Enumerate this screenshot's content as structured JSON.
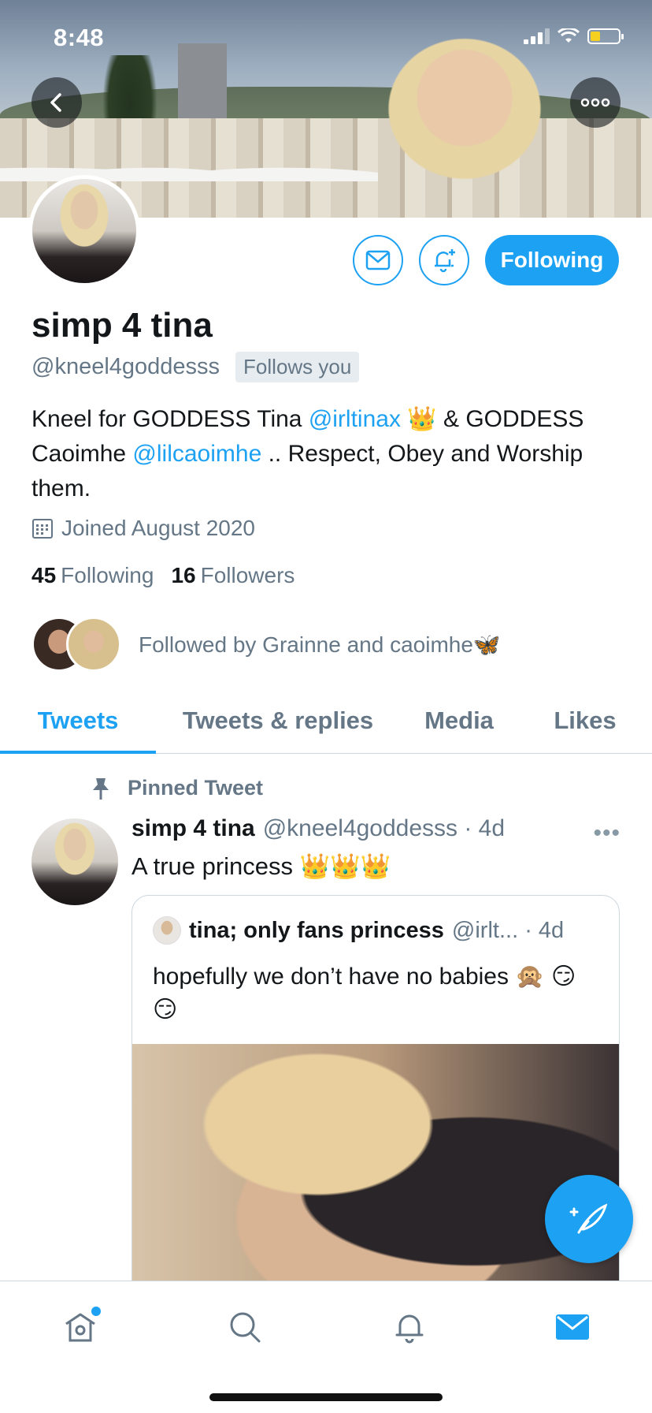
{
  "status_bar": {
    "time": "8:48"
  },
  "profile": {
    "display_name": "simp 4 tina",
    "handle": "@kneel4goddesss",
    "follows_you": "Follows you",
    "follow_button": "Following",
    "bio": {
      "part1": "Kneel for GODDESS Tina ",
      "mention1": "@irltinax",
      "part2": " 👑 & GODDESS Caoimhe ",
      "mention2": "@lilcaoimhe",
      "part3": " .. Respect, Obey and Worship them."
    },
    "joined": "Joined August 2020",
    "following_count": "45",
    "following_label": "Following",
    "followers_count": "16",
    "followers_label": "Followers",
    "followed_by": "Followed by Grainne and caoimhe🦋"
  },
  "tabs": [
    "Tweets",
    "Tweets & replies",
    "Media",
    "Likes"
  ],
  "active_tab": "Tweets",
  "pinned_tweet": {
    "pinned_label": "Pinned Tweet",
    "name": "simp 4 tina",
    "handle_time": "@kneel4goddesss · 4d",
    "text": "A true princess 👑👑👑",
    "quote": {
      "name": "tina; only fans princess",
      "handle_time": "@irlt... · 4d",
      "text": "hopefully we don’t have no babies 🙊 😏😏"
    }
  },
  "bottom_nav": [
    "home-icon",
    "search-icon",
    "notifications-icon",
    "messages-icon"
  ],
  "colors": {
    "accent": "#1da1f2",
    "secondary_text": "#657786"
  }
}
